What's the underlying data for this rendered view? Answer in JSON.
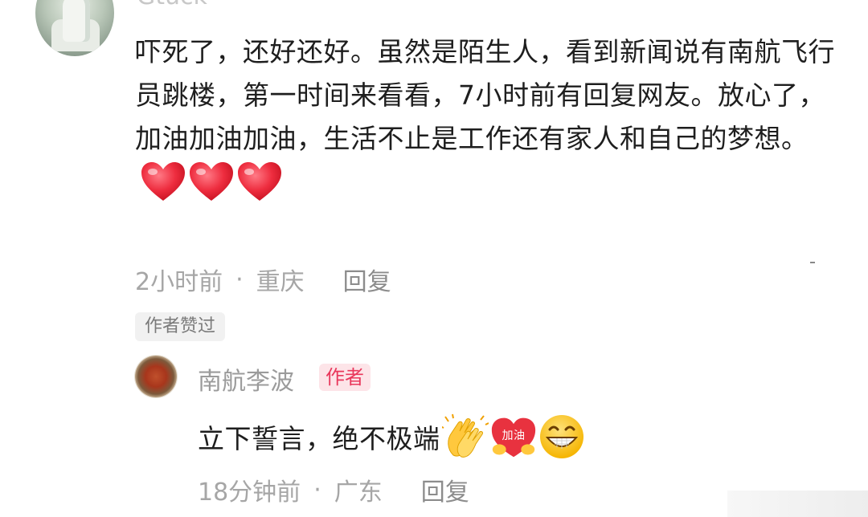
{
  "top_comment": {
    "username": "Gtuck",
    "text": "吓死了，还好还好。虽然是陌生人，看到新闻说有南航飞行员跳楼，第一时间来看看，7小时前有回复网友。放心了，加油加油加油，生活不止是工作还有家人和自己的梦想。",
    "time": "2小时前",
    "location": "重庆",
    "reply_label": "回复",
    "liked_badge": "作者赞过",
    "icons": [
      "red-heart-icon",
      "red-heart-icon",
      "red-heart-icon"
    ]
  },
  "reply": {
    "username": "南航李波",
    "author_badge": "作者",
    "text": "立下誓言，绝不极端",
    "time": "18分钟前",
    "location": "广东",
    "reply_label": "回复",
    "icons": [
      "clapping-hands-icon",
      "jiayou-heart-icon",
      "grinning-face-icon"
    ],
    "jiayou_text": "加油"
  },
  "colors": {
    "meta_gray": "#a6a6a6",
    "author_badge_bg": "#fde4e8",
    "author_badge_text": "#e9385c",
    "heart_red": "#ee2d3f"
  }
}
